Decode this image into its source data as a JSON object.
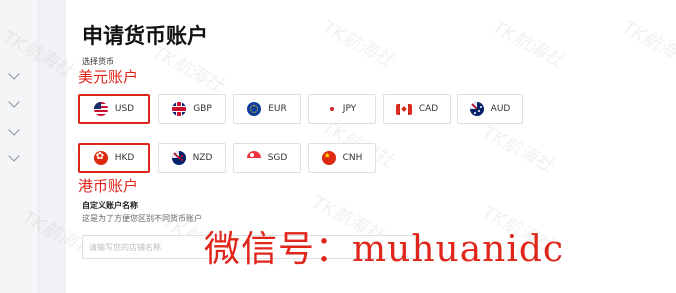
{
  "page": {
    "title": "申请货币账户",
    "currency_section_label": "选择货币"
  },
  "annotations": {
    "usd_label": "美元账户",
    "hkd_label": "港币账户",
    "color": "#e0261b"
  },
  "currencies": [
    {
      "code": "USD",
      "icon": "us-flag-icon",
      "selected": true
    },
    {
      "code": "GBP",
      "icon": "uk-flag-icon",
      "selected": false
    },
    {
      "code": "EUR",
      "icon": "eu-flag-icon",
      "selected": false
    },
    {
      "code": "JPY",
      "icon": "japan-flag-icon",
      "selected": false
    },
    {
      "code": "CAD",
      "icon": "canada-flag-icon",
      "selected": false
    },
    {
      "code": "AUD",
      "icon": "australia-flag-icon",
      "selected": false
    },
    {
      "code": "HKD",
      "icon": "hong-kong-flag-icon",
      "selected": true
    },
    {
      "code": "NZD",
      "icon": "new-zealand-flag-icon",
      "selected": false
    },
    {
      "code": "SGD",
      "icon": "singapore-flag-icon",
      "selected": false
    },
    {
      "code": "CNH",
      "icon": "china-flag-icon",
      "selected": false
    }
  ],
  "custom_name": {
    "label": "自定义账户名称",
    "hint": "这是为了方便您区别不同货币账户",
    "placeholder": "请输写您的店铺名称",
    "value": ""
  },
  "overlay": {
    "text": "微信号：muhuanidc"
  },
  "watermark": {
    "text": "TK航海社"
  }
}
